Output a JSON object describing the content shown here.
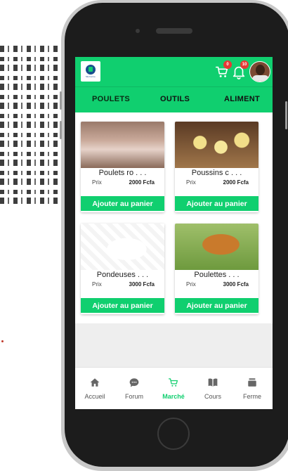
{
  "appbar": {
    "logo_text": "Ma Ferme",
    "cart_count": "0",
    "notif_count": "10"
  },
  "tabs": [
    {
      "label": "POULETS"
    },
    {
      "label": "OUTILS"
    },
    {
      "label": "ALIMENT"
    }
  ],
  "products": [
    {
      "title": "Poulets ro . . .",
      "price_label": "Prix",
      "price": "2000 Fcfa",
      "button": "Ajouter au panier"
    },
    {
      "title": "Poussins c . . .",
      "price_label": "Prix",
      "price": "2000 Fcfa",
      "button": "Ajouter au panier"
    },
    {
      "title": "Pondeuses . . .",
      "price_label": "Prix",
      "price": "3000 Fcfa",
      "button": "Ajouter au panier"
    },
    {
      "title": "Poulettes . . .",
      "price_label": "Prix",
      "price": "3000 Fcfa",
      "button": "Ajouter au panier"
    }
  ],
  "bottom_nav": [
    {
      "label": "Accueil",
      "icon": "home-icon"
    },
    {
      "label": "Forum",
      "icon": "chat-icon"
    },
    {
      "label": "Marché",
      "icon": "cart-icon"
    },
    {
      "label": "Cours",
      "icon": "book-icon"
    },
    {
      "label": "Ferme",
      "icon": "stack-icon"
    }
  ],
  "colors": {
    "accent": "#10cf6f",
    "badge": "#e53935"
  }
}
